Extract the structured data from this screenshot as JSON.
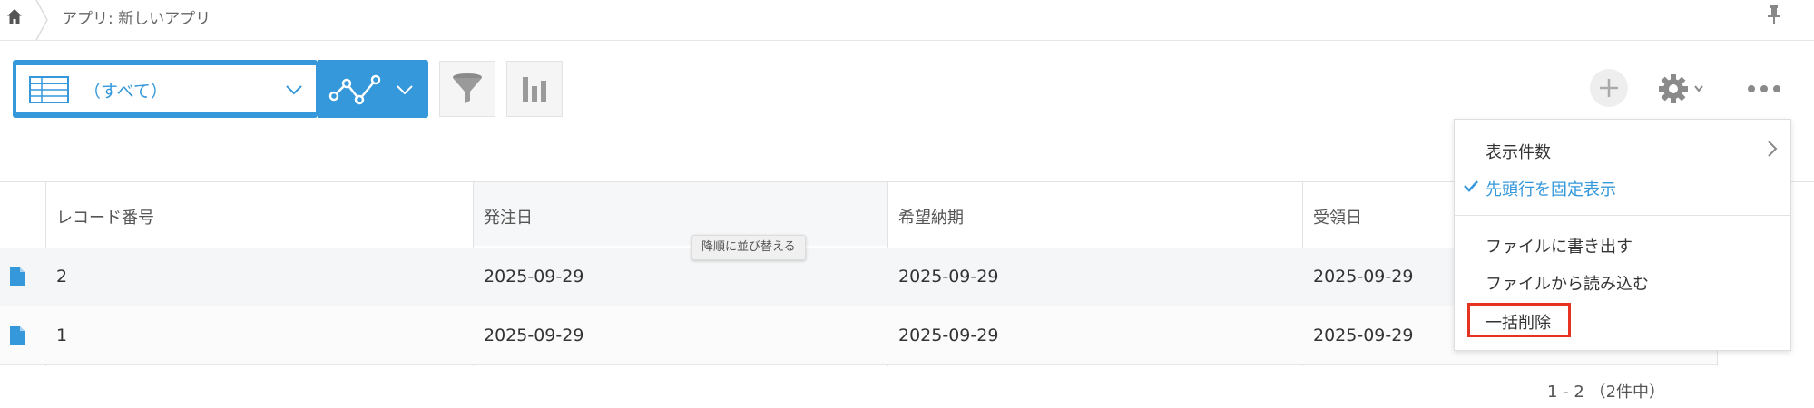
{
  "breadcrumb": {
    "app_path": "アプリ: 新しいアプリ"
  },
  "toolbar": {
    "view_label": "（すべて）",
    "icons": [
      "home-icon",
      "pin-icon",
      "table-view-icon",
      "graph-icon",
      "filter-icon",
      "bar-chart-icon",
      "plus-icon",
      "gear-icon",
      "more-icon"
    ]
  },
  "table": {
    "headers": [
      "レコード番号",
      "発注日",
      "希望納期",
      "受領日"
    ],
    "sort_tooltip": "降順に並び替える",
    "rows": [
      {
        "record_no": "2",
        "order_date": "2025-09-29",
        "delivery_date": "2025-09-29",
        "received_date": "2025-09-29"
      },
      {
        "record_no": "1",
        "order_date": "2025-09-29",
        "delivery_date": "2025-09-29",
        "received_date": "2025-09-29"
      }
    ]
  },
  "pagination": {
    "text": "1 - 2 （2件中）"
  },
  "menu": {
    "items": [
      {
        "label": "表示件数"
      },
      {
        "label": "先頭行を固定表示"
      },
      {
        "label": "ファイルに書き出す"
      },
      {
        "label": "ファイルから読み込む"
      },
      {
        "label": "一括削除"
      }
    ]
  },
  "colors": {
    "accent": "#3498db",
    "highlight": "#e53322"
  }
}
